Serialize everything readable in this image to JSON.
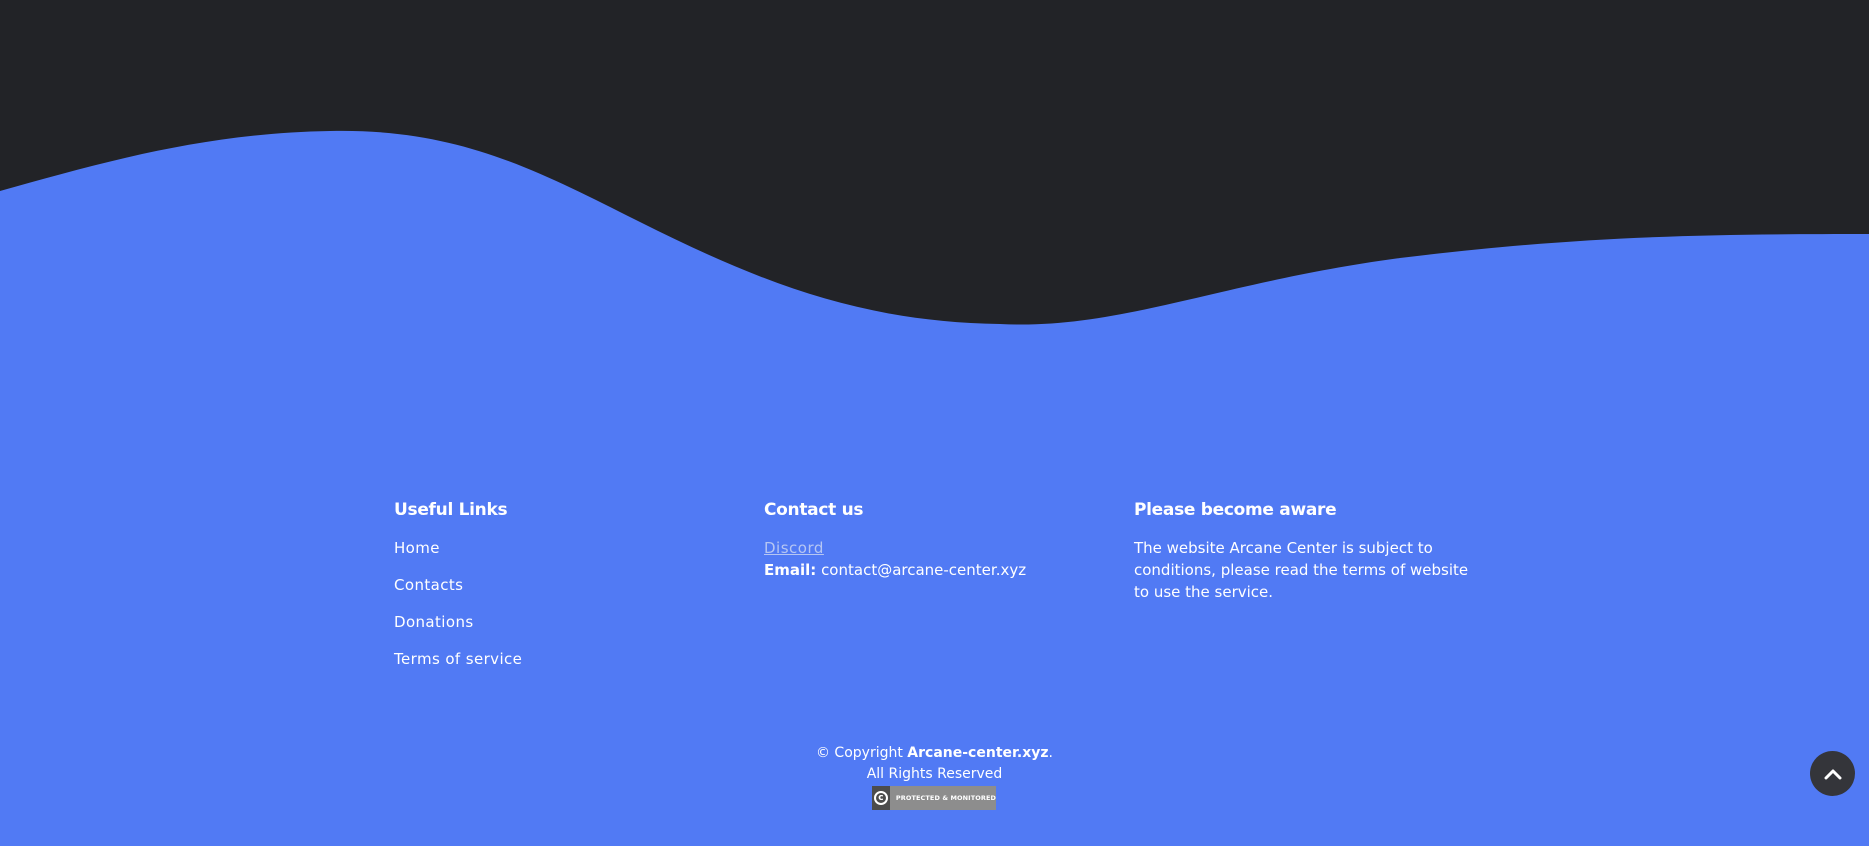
{
  "colors": {
    "dark_band": "#222327",
    "footer_bg": "#517af4",
    "link_muted": "#b6c6f3",
    "scroll_button": "#34353a"
  },
  "useful_links": {
    "title": "Useful Links",
    "items": [
      {
        "label": "Home"
      },
      {
        "label": "Contacts"
      },
      {
        "label": "Donations"
      },
      {
        "label": "Terms of service"
      }
    ]
  },
  "contact": {
    "title": "Contact us",
    "discord_label": "Discord",
    "email_label": "Email:",
    "email_value": "contact@arcane-center.xyz"
  },
  "aware": {
    "title": "Please become aware",
    "text": "The website Arcane Center is subject to conditions, please read the terms of website to use the service."
  },
  "copyright": {
    "prefix": "© Copyright",
    "brand": "Arcane-center.xyz",
    "suffix": ".",
    "rights": "All Rights Reserved"
  },
  "badge": {
    "text": "PROTECTED & MONITORED",
    "icon": "copyright-icon"
  },
  "back_to_top": {
    "icon": "chevron-up-icon"
  }
}
